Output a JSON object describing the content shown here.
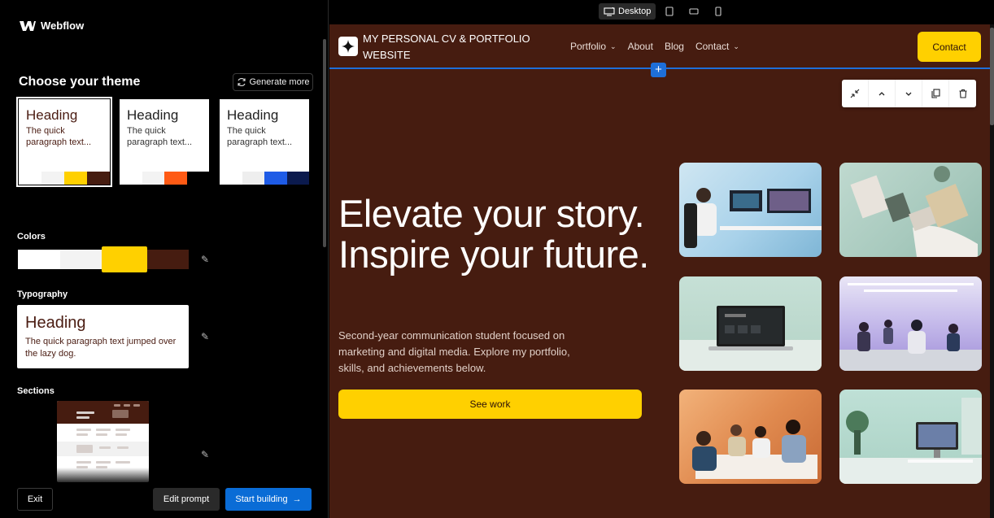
{
  "app": {
    "name": "Webflow"
  },
  "left_panel": {
    "theme_title": "Choose your theme",
    "generate_more": "Generate more",
    "themes": [
      {
        "heading": "Heading",
        "paragraph": "The quick paragraph text...",
        "swatches": [
          "#ffffff",
          "#f3f3f3",
          "#ffd000",
          "#461c10"
        ]
      },
      {
        "heading": "Heading",
        "paragraph": "The quick paragraph text...",
        "swatches": [
          "#ffffff",
          "#f3f3f3",
          "#ff5a14",
          "#000000"
        ]
      },
      {
        "heading": "Heading",
        "paragraph": "The quick paragraph text...",
        "swatches": [
          "#ffffff",
          "#eeeeee",
          "#1e5be6",
          "#0b1a4d"
        ]
      }
    ],
    "colors_label": "Colors",
    "colors": [
      "#ffffff",
      "#f3f3f3",
      "#ffd000",
      "#461c10"
    ],
    "typography_label": "Typography",
    "typography": {
      "heading": "Heading",
      "paragraph": "The quick paragraph text jumped over the lazy dog."
    },
    "sections_label": "Sections",
    "buttons": {
      "exit": "Exit",
      "edit_prompt": "Edit prompt",
      "start_building": "Start building"
    }
  },
  "devicebar": {
    "active": "Desktop"
  },
  "site": {
    "brand": "MY PERSONAL CV & PORTFOLIO WEBSITE",
    "nav": [
      "Portfolio",
      "About",
      "Blog",
      "Contact"
    ],
    "contact_button": "Contact",
    "hero_title": "Elevate your story. Inspire your future.",
    "hero_subtitle": "Second-year communication student focused on marketing and digital media. Explore my portfolio, skills, and achievements below.",
    "cta": "See work",
    "accent": "#ffd000",
    "background": "#461c10"
  }
}
